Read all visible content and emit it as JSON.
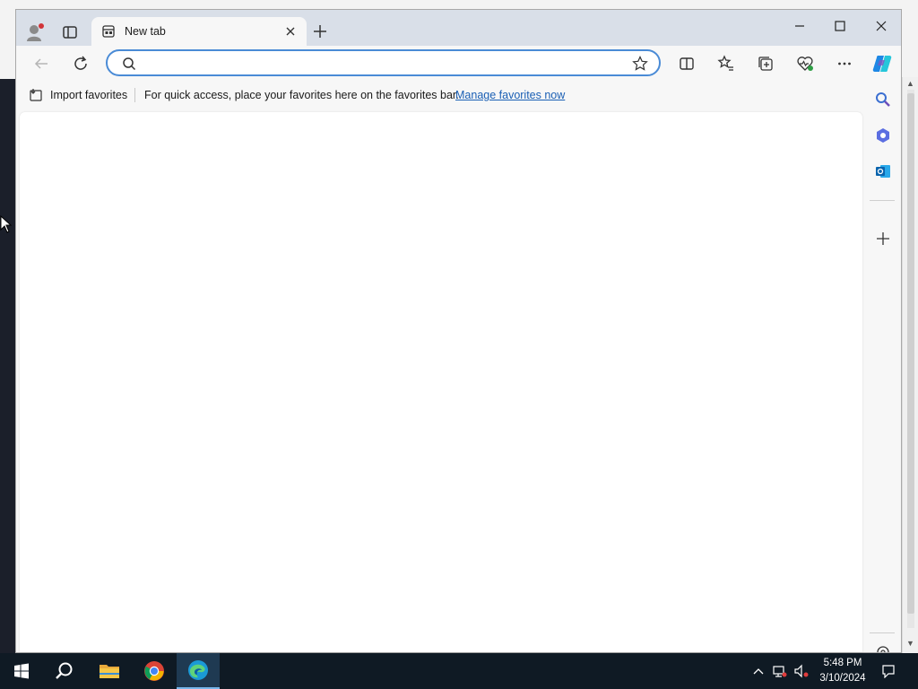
{
  "browser": {
    "tab": {
      "title": "New tab"
    },
    "address_bar": {
      "value": "",
      "placeholder": ""
    },
    "favorites_bar": {
      "import_label": "Import favorites",
      "message": "For quick access, place your favorites here on the favorites bar.",
      "manage_link": "Manage favorites now"
    }
  },
  "taskbar": {
    "apps": [
      "start-icon",
      "search-icon",
      "file-explorer-icon",
      "chrome-icon",
      "edge-icon"
    ],
    "clock": {
      "time": "5:48 PM",
      "date": "3/10/2024"
    }
  },
  "colors": {
    "accent": "#4a8bd6",
    "link": "#1a5fb4",
    "taskbar": "#0f1a24",
    "titlebar": "#d9dfe8"
  }
}
